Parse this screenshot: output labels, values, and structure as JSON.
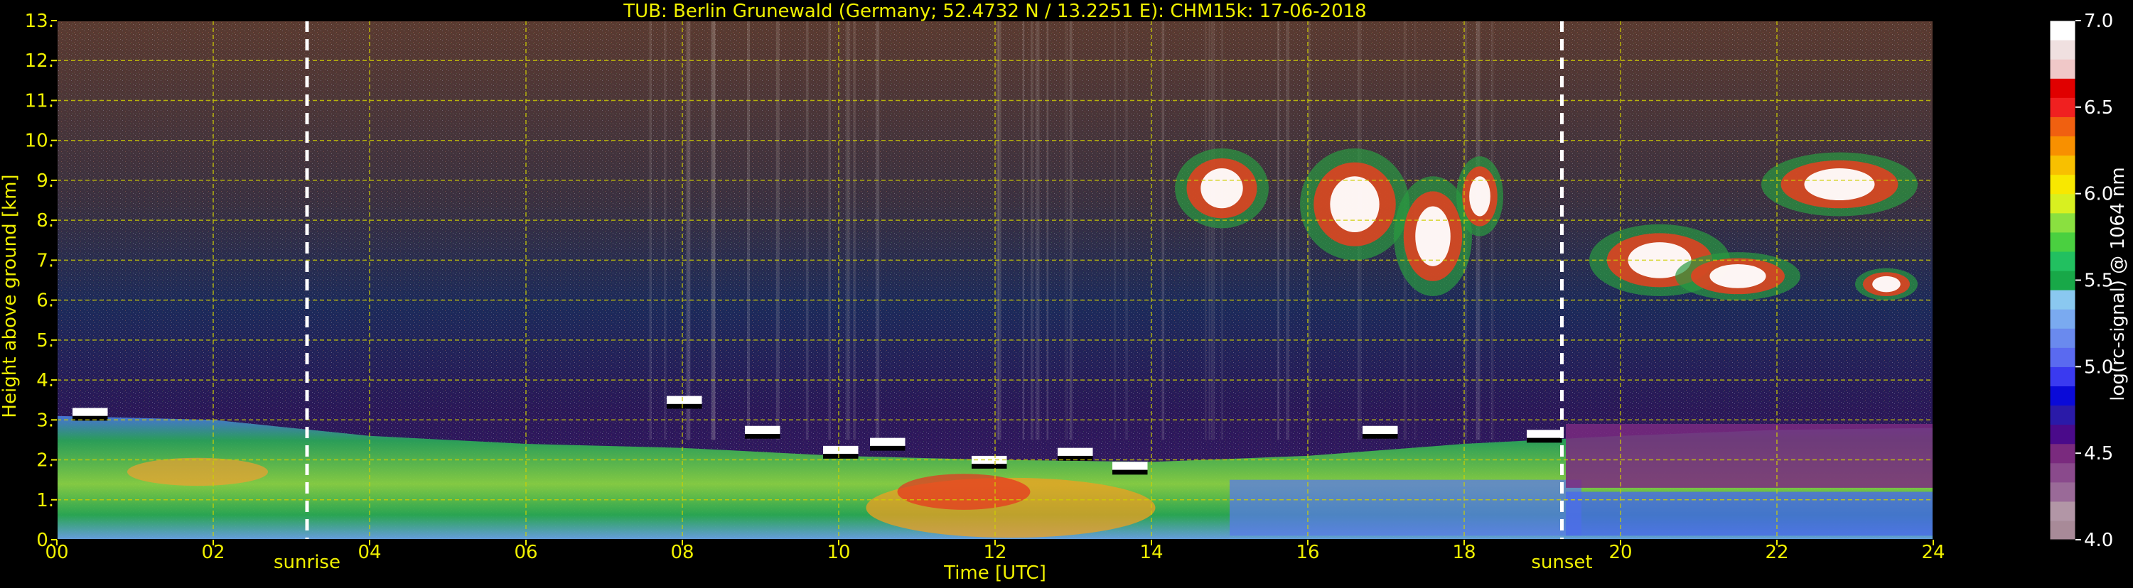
{
  "chart_data": {
    "type": "heatmap",
    "title": "TUB: Berlin Grunewald (Germany; 52.4732 N / 13.2251 E):    CHM15k: 17-06-2018",
    "xlabel": "Time [UTC]",
    "ylabel": "Height above ground [km]",
    "xlim": [
      0,
      24
    ],
    "ylim": [
      0,
      13
    ],
    "x_ticks": [
      "00",
      "02",
      "04",
      "06",
      "08",
      "10",
      "12",
      "14",
      "16",
      "18",
      "20",
      "22",
      "24"
    ],
    "y_ticks": [
      "0.",
      "1.",
      "2.",
      "3.",
      "4.",
      "5.",
      "6.",
      "7.",
      "8.",
      "9.",
      "10.",
      "11.",
      "12.",
      "13."
    ],
    "grid": true,
    "colorbar": {
      "label": "log(rc-signal) @ 1064 nm",
      "range": [
        4.0,
        7.0
      ],
      "ticks": [
        "4.0",
        "4.5",
        "5.0",
        "5.5",
        "6.0",
        "6.5",
        "7.0"
      ],
      "colors": [
        "#a88a98",
        "#b296a6",
        "#9a6a98",
        "#8a4a8c",
        "#7a2a7e",
        "#4a0a8a",
        "#2a1aa8",
        "#0a0ad8",
        "#3a3af0",
        "#5a6af0",
        "#6a8aee",
        "#7aaaf0",
        "#8ac8f0",
        "#18a848",
        "#22c060",
        "#4ad040",
        "#8ae040",
        "#d8f020",
        "#f8e800",
        "#f8c000",
        "#f89000",
        "#f06010",
        "#f02020",
        "#e00000",
        "#f0c8c8",
        "#f0e0e0",
        "#ffffff"
      ]
    },
    "annotations": [
      {
        "label": "sunrise",
        "x": 3.2
      },
      {
        "label": "sunset",
        "x": 19.25
      }
    ],
    "layers": [
      {
        "name": "boundary-layer",
        "top_km": [
          3.1,
          3.0,
          2.6,
          2.4,
          2.3,
          2.1,
          2.0,
          1.95,
          2.1,
          2.4,
          2.6,
          2.75,
          2.8
        ]
      },
      {
        "name": "cirrus",
        "x_range": [
          14.0,
          24.0
        ],
        "y_range": [
          6.0,
          10.5
        ]
      }
    ]
  }
}
